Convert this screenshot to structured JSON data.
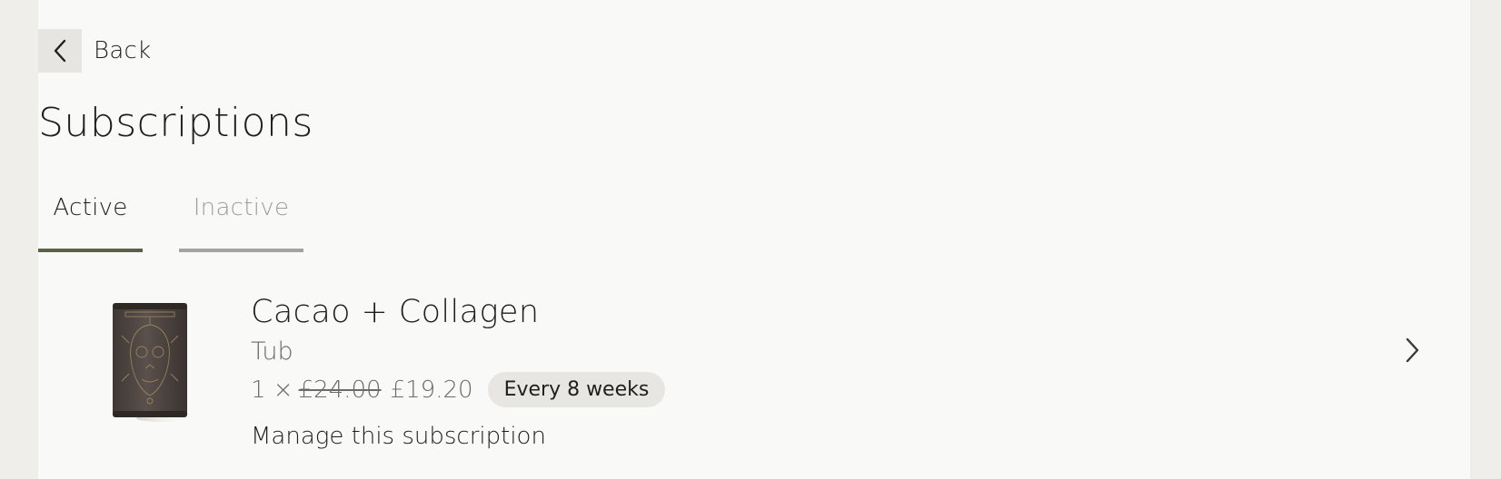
{
  "back": {
    "label": "Back",
    "icon": "chevron-left-icon"
  },
  "page": {
    "title": "Subscriptions"
  },
  "tabs": [
    {
      "label": "Active",
      "selected": true
    },
    {
      "label": "Inactive",
      "selected": false
    }
  ],
  "subscription": {
    "product_name": "Cacao + Collagen",
    "variant": "Tub",
    "quantity": "1 ×",
    "original_price": "£24.00",
    "price": "£19.20",
    "frequency": "Every 8 weeks",
    "manage_label": "Manage this subscription",
    "chevron_icon": "chevron-right-icon"
  },
  "colors": {
    "background": "#efeeea",
    "panel": "#f9f9f7",
    "active_tab_underline": "#5a6049",
    "inactive_tab_underline": "#a3a3a0",
    "badge_bg": "#e7e6e3"
  }
}
